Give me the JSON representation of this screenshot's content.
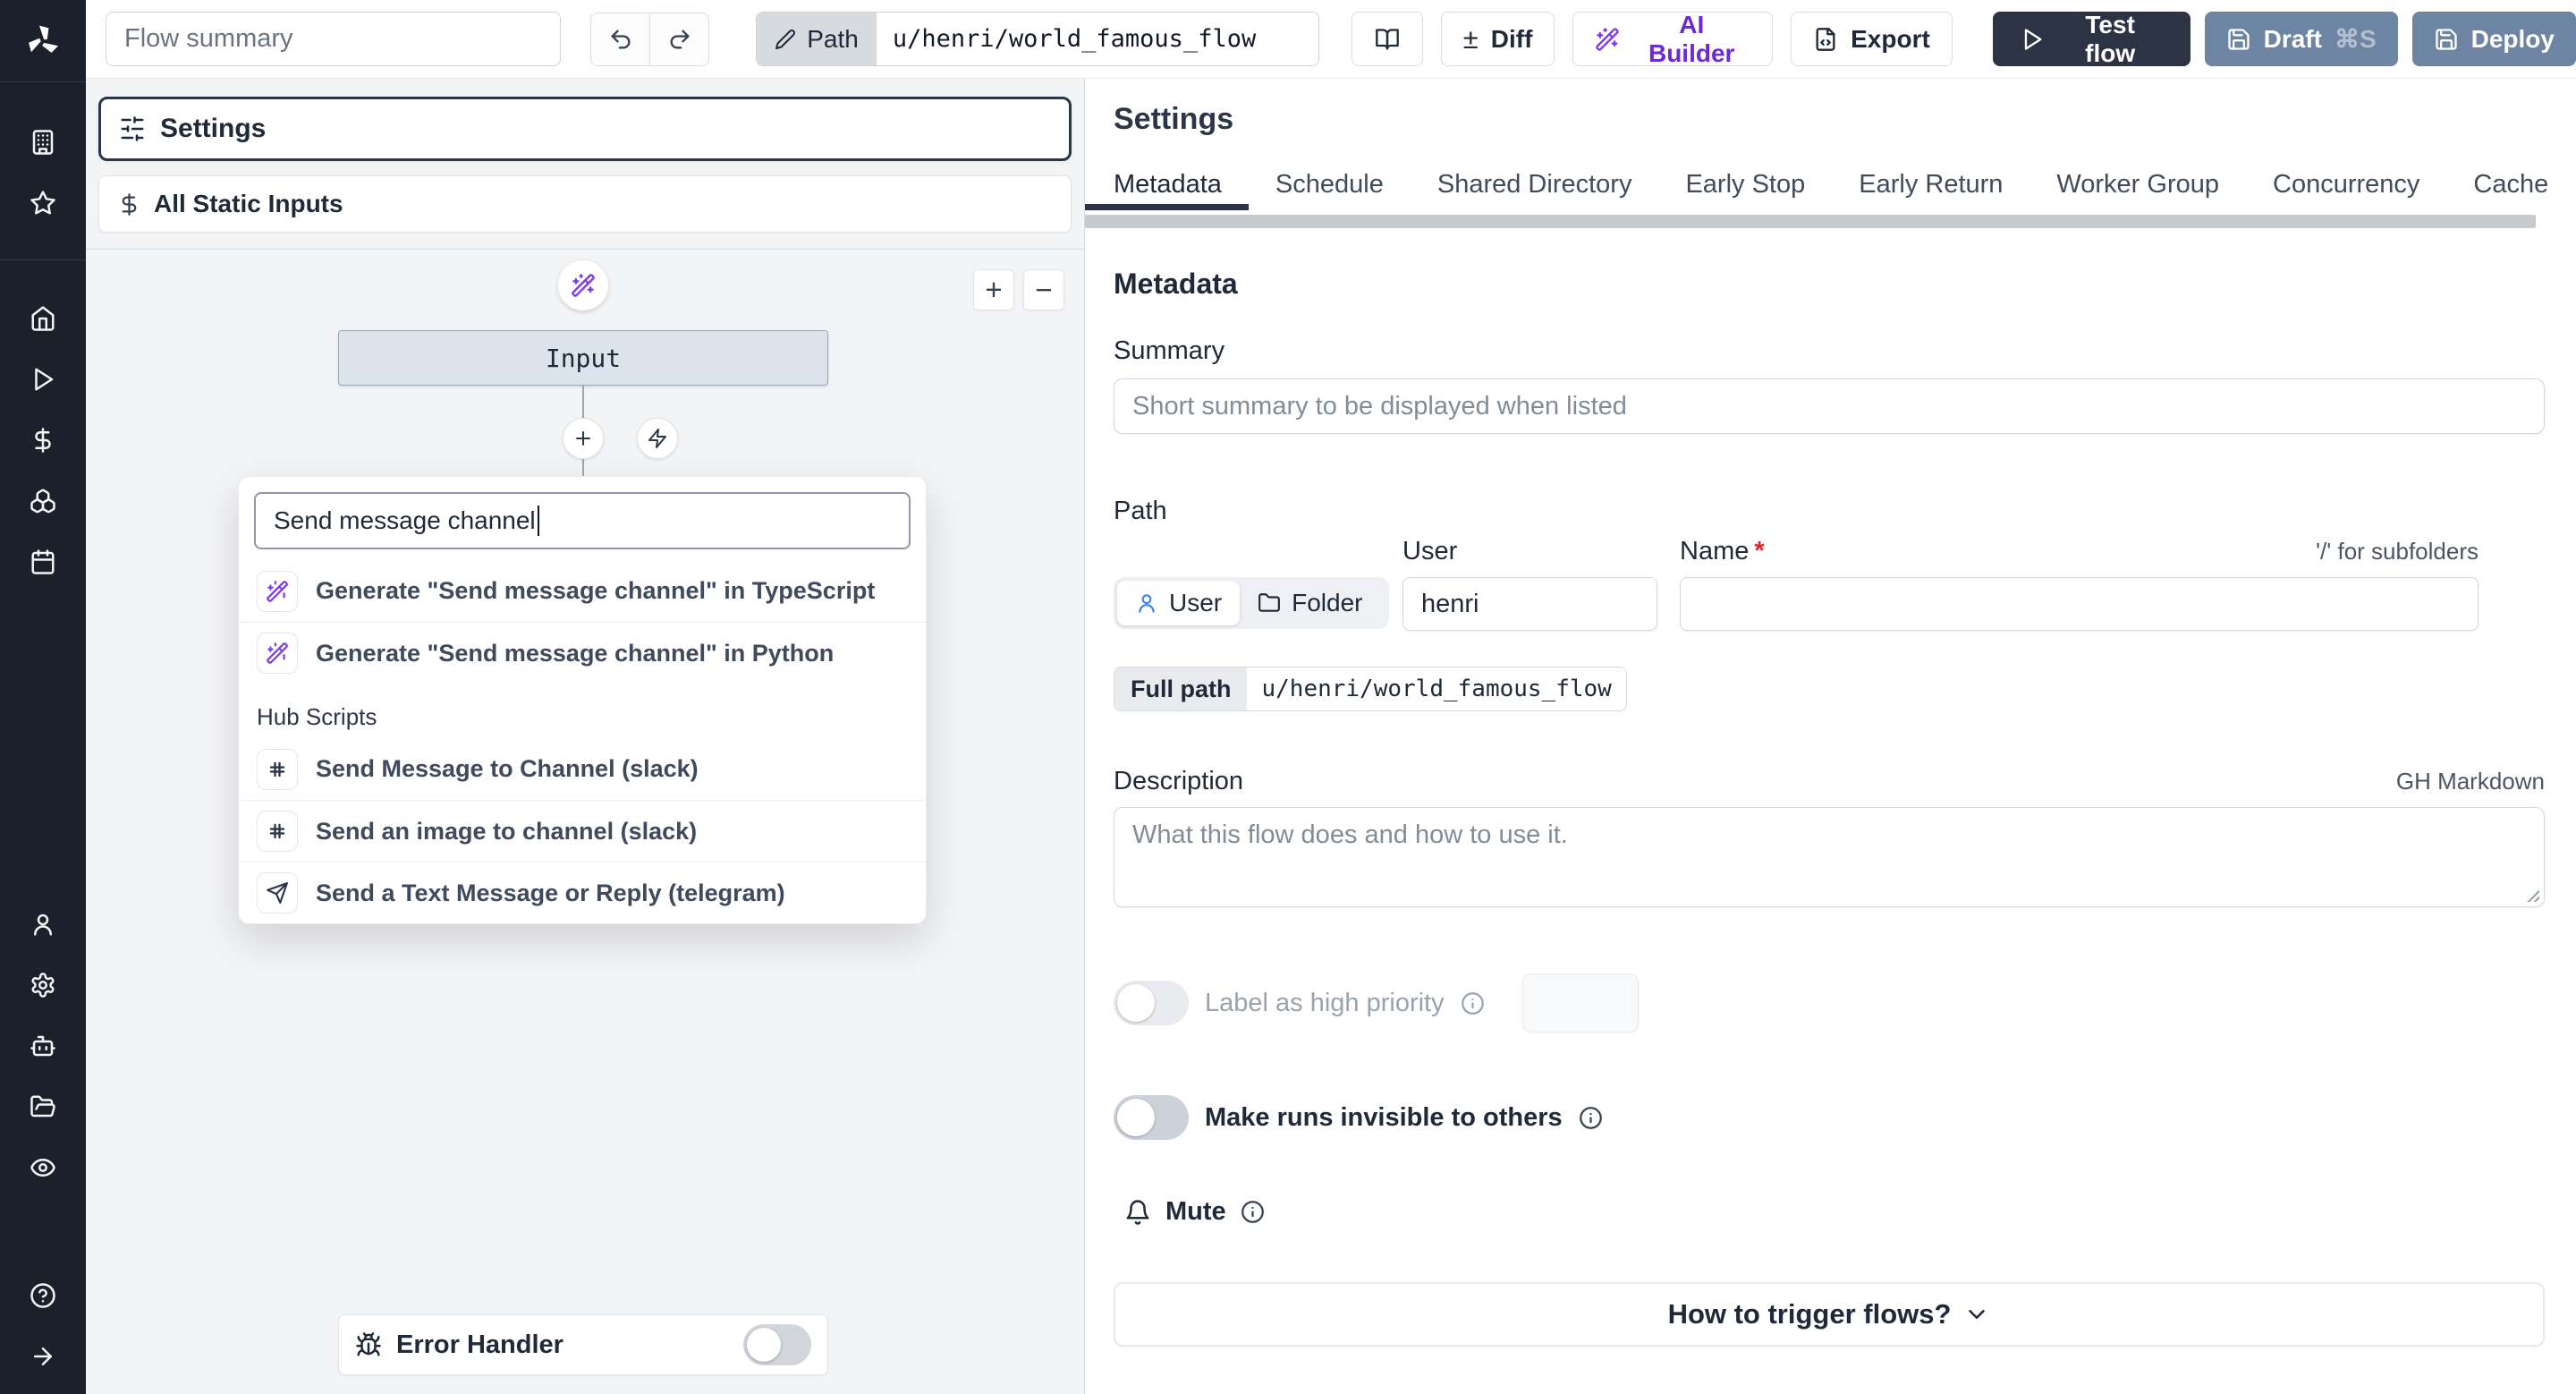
{
  "app": {
    "name": "Windmill flow editor"
  },
  "colors": {
    "sidebar_bg": "#1b202b",
    "accent_purple": "#7c3aed",
    "dark_navy_button": "#2c3344",
    "deploy_blue": "#6e84a3",
    "selected_blue": "#3b82f6",
    "canvas_bg": "#f3f4f6"
  },
  "topbar": {
    "flow_summary_placeholder": "Flow summary",
    "path_label": "Path",
    "path_value": "u/henri/world_famous_flow",
    "diff_symbol": "±",
    "diff_label": "Diff",
    "ai_builder_label": "AI Builder",
    "export_label": "Export",
    "test_flow_label": "Test flow",
    "draft_label": "Draft",
    "draft_shortcut": "⌘S",
    "deploy_label": "Deploy"
  },
  "sidebar": {
    "icons": [
      "windmill-logo",
      "building",
      "star",
      "home",
      "play",
      "dollar",
      "boxes",
      "calendar",
      "user",
      "gear",
      "bot",
      "folder-open",
      "eye",
      "help-circle",
      "arrow-right"
    ]
  },
  "flow_panel": {
    "settings_label": "Settings",
    "static_inputs_label": "All Static Inputs",
    "zoom_in_label": "+",
    "zoom_out_label": "−",
    "input_node_label": "Input",
    "search_value": "Send message channel",
    "hub_scripts_label": "Hub Scripts",
    "results": [
      {
        "icon": "wand-icon",
        "label": "Generate \"Send message channel\" in TypeScript"
      },
      {
        "icon": "wand-icon",
        "label": "Generate \"Send message channel\" in Python"
      },
      {
        "icon": "slack-icon",
        "label": "Send Message to Channel (slack)"
      },
      {
        "icon": "slack-icon",
        "label": "Send an image to channel (slack)"
      },
      {
        "icon": "send-icon",
        "label": "Send a Text Message or Reply (telegram)"
      }
    ],
    "error_handler_label": "Error Handler"
  },
  "settings_panel": {
    "title": "Settings",
    "active_tab": "Metadata",
    "tabs": [
      "Metadata",
      "Schedule",
      "Shared Directory",
      "Early Stop",
      "Early Return",
      "Worker Group",
      "Concurrency",
      "Cache"
    ],
    "metadata": {
      "heading": "Metadata",
      "summary_label": "Summary",
      "summary_placeholder": "Short summary to be displayed when listed",
      "path_label": "Path",
      "user_tab": "User",
      "folder_tab": "Folder",
      "user_label": "User",
      "user_value": "henri",
      "name_label": "Name",
      "name_required": "*",
      "subfolder_hint": "'/' for subfolders",
      "full_path_label": "Full path",
      "full_path_value": "u/henri/world_famous_flow",
      "description_label": "Description",
      "markdown_hint": "GH Markdown",
      "description_placeholder": "What this flow does and how to use it.",
      "high_priority_label": "Label as high priority",
      "invisible_runs_label": "Make runs invisible to others",
      "mute_label": "Mute",
      "trigger_accordion_label": "How to trigger flows?"
    }
  }
}
